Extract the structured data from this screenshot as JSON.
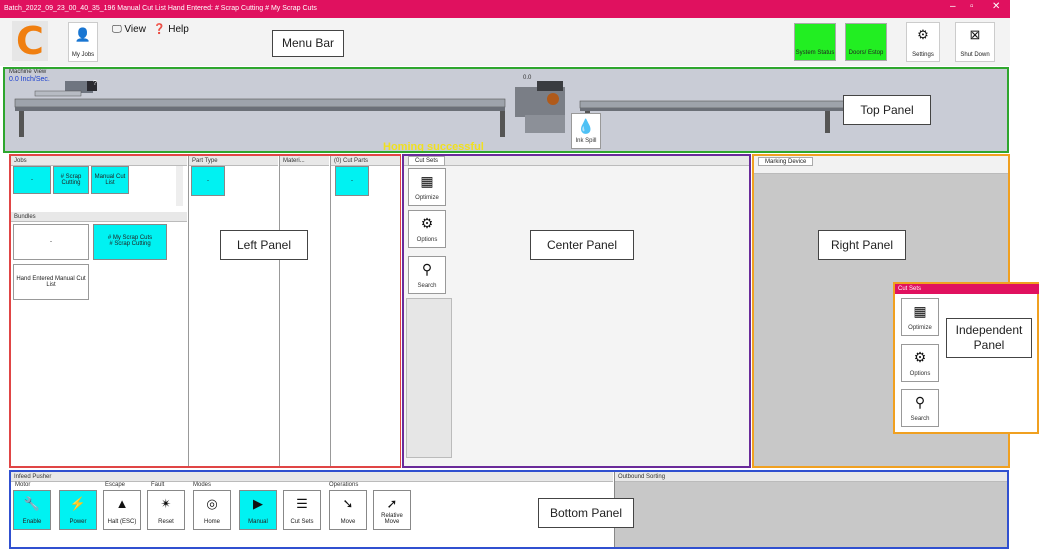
{
  "titlebar": {
    "text": "Batch_2022_09_23_00_40_35_196 Manual Cut List Hand Entered: # Scrap Cutting # My Scrap Cuts",
    "min": "–",
    "max": "▫",
    "close": "✕"
  },
  "menubar": {
    "logo": "C",
    "my_jobs": "My Jobs",
    "view": "View",
    "help": "Help",
    "system_status": "System Status",
    "doors_estop": "Doors/ Estop",
    "settings": "Settings",
    "shutdown": "Shut Down"
  },
  "callouts": {
    "menu_bar": "Menu Bar",
    "top_panel": "Top Panel",
    "left_panel": "Left Panel",
    "center_panel": "Center Panel",
    "right_panel": "Right Panel",
    "independent_panel": "Independent Panel",
    "bottom_panel": "Bottom Panel"
  },
  "machine_view": {
    "title": "Machine View",
    "speed": "0.0 Inch/Sec.",
    "dim": "0.0",
    "ink_spill": "Ink Spill",
    "homing": "Homing successful"
  },
  "jobs": {
    "title": "Jobs",
    "pin": "ᵖ",
    "cards": [
      "-",
      "# Scrap Cutting",
      "Manual Cut List"
    ]
  },
  "bundles": {
    "title": "Bundles",
    "pin": "ᵖ",
    "cards": [
      "-",
      "# My Scrap Cuts\n# Scrap Cutting",
      "Hand Entered Manual Cut List"
    ]
  },
  "columns": {
    "part_type": "Part Type",
    "material": "Materi...",
    "cut_parts": "(0) Cut Parts",
    "pin": "ᵖ",
    "part_card": "-",
    "cut_card": "-"
  },
  "cut_sets": {
    "tab": "Cut Sets",
    "optimize": "Optimize",
    "options": "Options",
    "search": "Search"
  },
  "marking": {
    "tab": "Marking Device"
  },
  "independent": {
    "title": "Cut Sets",
    "optimize": "Optimize",
    "options": "Options",
    "search": "Search"
  },
  "bottom": {
    "feed_pusher": "Infeed Pusher",
    "outbound": "Outbound Sorting",
    "groups": {
      "motor": "Motor",
      "escape": "Escape",
      "fault": "Fault",
      "modes": "Modes",
      "operations": "Operations"
    },
    "buttons": {
      "enable": "Enable",
      "power": "Power",
      "halt": "Halt (ESC)",
      "reset": "Reset",
      "home": "Home",
      "manual": "Manual",
      "cut_sets": "Cut Sets",
      "move": "Move",
      "relative_move": "Relative Move"
    }
  },
  "colors": {
    "titlebar": "#e0115f",
    "logo": "#f07f10",
    "cyan": "#00f2f2",
    "green": "#22ee22",
    "top_frame": "#2ea62e",
    "left_frame": "#e04545",
    "center_frame": "#6a2a9a",
    "right_frame": "#f0a020",
    "bottom_frame": "#3050d0",
    "homing": "#f0e020"
  }
}
